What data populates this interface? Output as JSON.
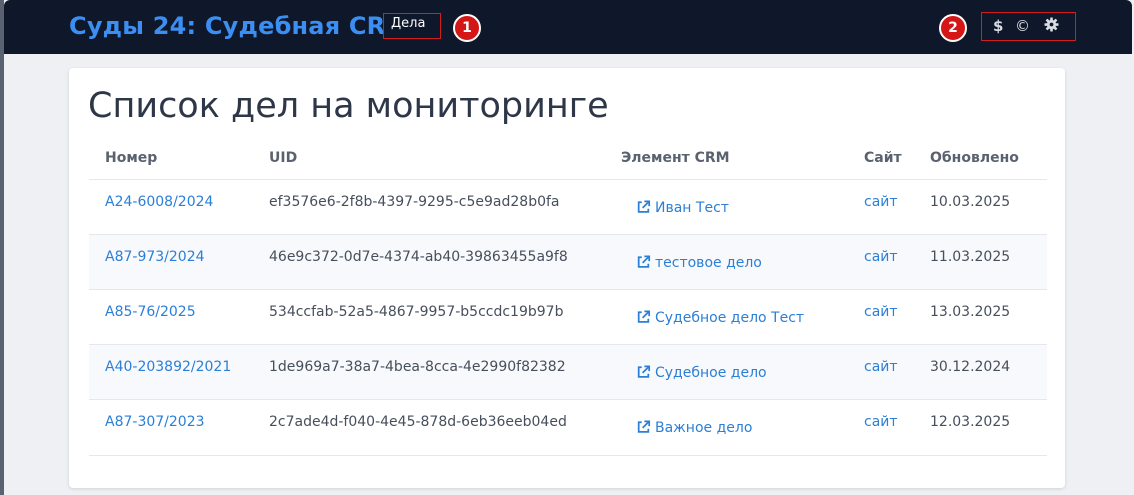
{
  "app": {
    "title": "Суды 24: Судебная CRM",
    "nav_link": "Дела",
    "markers": [
      "1",
      "2"
    ],
    "toolbar_icons": [
      "dollar-icon",
      "copyright-icon",
      "gear-icon"
    ]
  },
  "colors": {
    "topbar": "#0f172a",
    "title_accent": "#3b8ff3",
    "link": "#2b7fd6",
    "marker": "#d41616"
  },
  "main": {
    "page_title": "Список дел на мониторинге",
    "columns": [
      "Номер",
      "UID",
      "Элемент CRM",
      "Сайт",
      "Обновлено"
    ],
    "rows": [
      {
        "number": "A24-6008/2024",
        "uid": "ef3576e6-2f8b-4397-9295-c5e9ad28b0fa",
        "crm": "Иван Тест",
        "site": "сайт",
        "updated": "10.03.2025"
      },
      {
        "number": "A87-973/2024",
        "uid": "46e9c372-0d7e-4374-ab40-39863455a9f8",
        "crm": "тестовое дело",
        "site": "сайт",
        "updated": "11.03.2025"
      },
      {
        "number": "A85-76/2025",
        "uid": "534ccfab-52a5-4867-9957-b5ccdc19b97b",
        "crm": "Судебное дело Тест",
        "site": "сайт",
        "updated": "13.03.2025"
      },
      {
        "number": "A40-203892/2021",
        "uid": "1de969a7-38a7-4bea-8cca-4e2990f82382",
        "crm": "Судебное дело",
        "site": "сайт",
        "updated": "30.12.2024"
      },
      {
        "number": "A87-307/2023",
        "uid": "2c7ade4d-f040-4e45-878d-6eb36eeb04ed",
        "crm": "Важное дело",
        "site": "сайт",
        "updated": "12.03.2025"
      }
    ]
  }
}
